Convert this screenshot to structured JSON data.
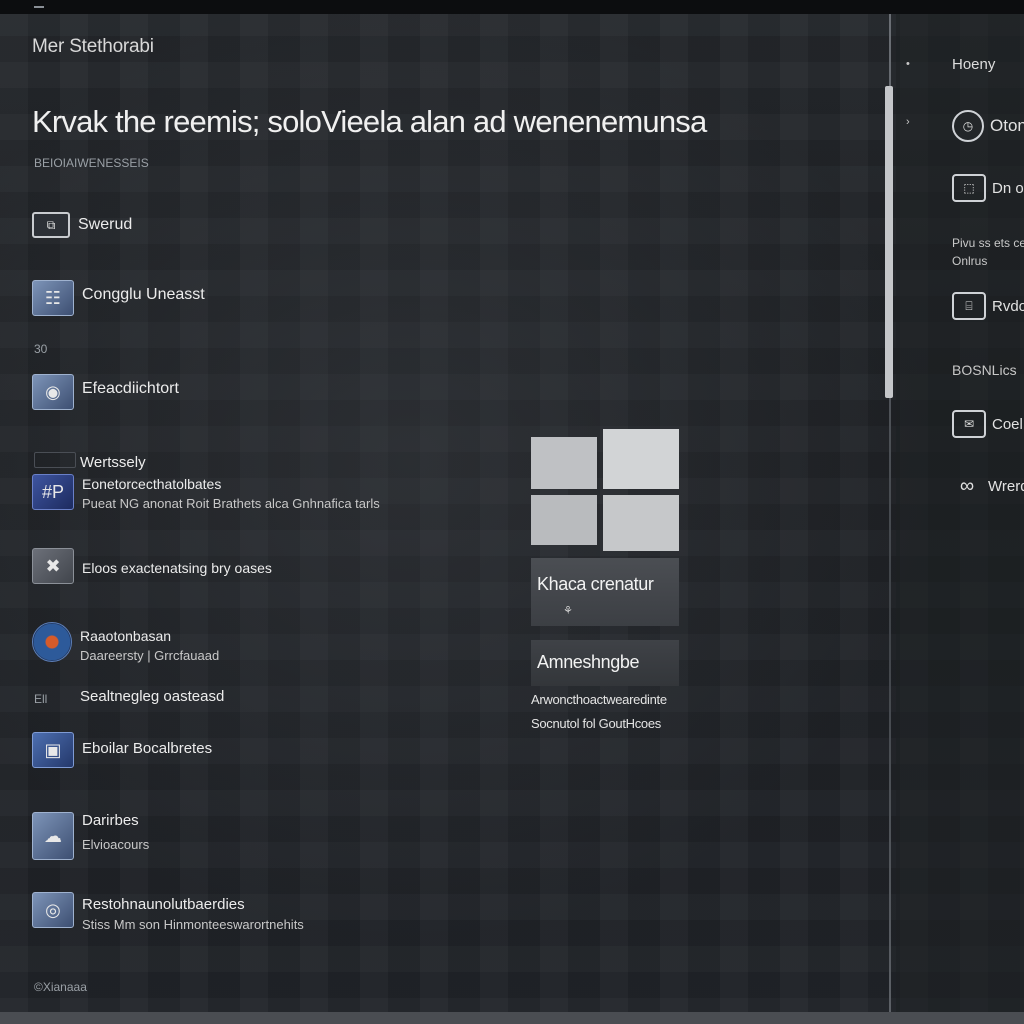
{
  "window": {
    "app_title": "Mer Stethorabi",
    "headline": "Krvak the reemis; solo​Vieela alan ad wenenemunsa",
    "subcaption": "BEIOIAIWENESSEIS"
  },
  "menu": {
    "items": [
      {
        "label": "Swerud",
        "desc": "",
        "icon": "folder-icon",
        "glyph": "⧉"
      },
      {
        "label": "Congglu Uneasst",
        "desc": "",
        "icon": "document-icon",
        "glyph": "☷"
      },
      {
        "label": "Efeacdiichtort",
        "desc": "",
        "icon": "image-icon",
        "glyph": "◉"
      },
      {
        "label": "Wertssely",
        "desc": "",
        "icon": "",
        "glyph": ""
      },
      {
        "label": "Eonetorcecthatolbates",
        "desc": "Pueat NG anonat Roit Brathets alca Gnhnafica tarls",
        "icon": "app-icon",
        "glyph": "#P"
      },
      {
        "label": "Eloos exactenatsing bry oases",
        "desc": "",
        "icon": "tools-icon",
        "glyph": "✖"
      },
      {
        "label": "Raaotonbasan",
        "desc": "Daareersty | Grrcfauaad",
        "icon": "browser-icon",
        "glyph": ""
      },
      {
        "label": "Sealtnegleg oasteasd",
        "desc": "",
        "icon": "",
        "glyph": ""
      },
      {
        "label": "Eboilar Bocalbretes",
        "desc": "",
        "icon": "window-icon",
        "glyph": "▣"
      },
      {
        "label": "Darirbes",
        "desc": "Elvioacours",
        "icon": "cloud-icon",
        "glyph": "☁"
      },
      {
        "label": "Restohnaunolutbaerdies",
        "desc": "Stiss Mm son Hinmonteeswarortnehits",
        "icon": "camera-icon",
        "glyph": "◎"
      }
    ],
    "stray_marks": [
      "30",
      "Ell",
      "©Xianaaa"
    ]
  },
  "center": {
    "logo": "windows-logo-icon",
    "tile_1": {
      "label": "Khaca crenatur",
      "glyph": "⚘"
    },
    "tile_2": {
      "label": "Amneshngbe"
    },
    "desc_1": "Arwoncthoactwearedinte",
    "desc_2": "Socnutol fol GoutHcoes"
  },
  "right_pane": {
    "title": "Hoeny",
    "items": [
      {
        "label": "Otone",
        "icon": "clock-icon",
        "glyph": "◷"
      },
      {
        "label": "Dn o",
        "icon": "monitor-icon",
        "glyph": "⬚"
      },
      {
        "label": "Rvdo",
        "icon": "folder-icon",
        "glyph": "⌸"
      },
      {
        "label": "Coel",
        "icon": "mail-icon",
        "glyph": "✉"
      },
      {
        "label": "Wrerd",
        "icon": "link-icon",
        "glyph": "∞"
      }
    ],
    "text_1": "Pivu ss ets celo",
    "text_2": "Onlrus",
    "text_3": "BOSNLics"
  },
  "colors": {
    "background": "#1f2226",
    "accent": "#3e55a0",
    "text": "#ececec"
  }
}
